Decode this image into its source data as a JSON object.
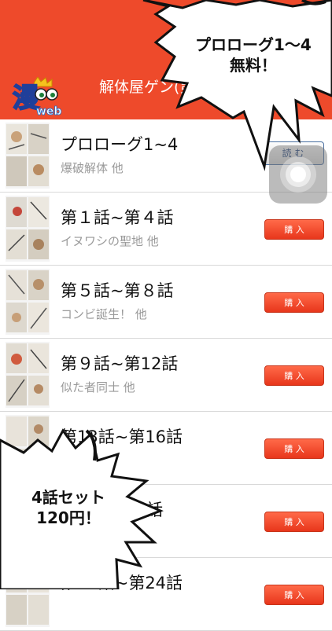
{
  "header": {
    "title": "解体屋ゲン(第",
    "logo_text": "web",
    "logo_char": "漫"
  },
  "episodes": [
    {
      "title": "プロローグ1~4",
      "subtitle": "爆破解体 他",
      "button": "読 む"
    },
    {
      "title": "第１話~第４話",
      "subtitle": "イヌワシの聖地 他",
      "button": "購 入"
    },
    {
      "title": "第５話~第８話",
      "subtitle": "コンビ誕生！ 他",
      "button": "購 入"
    },
    {
      "title": "第９話~第12話",
      "subtitle": "似た者同士 他",
      "button": "購 入"
    },
    {
      "title": "第13話~第16話",
      "subtitle": "",
      "button": "購 入"
    },
    {
      "title": "話",
      "subtitle": "",
      "button": "購 入"
    },
    {
      "title": "第21話~第24話",
      "subtitle": "",
      "button": "購 入"
    }
  ],
  "callouts": {
    "top": {
      "line1": "プロローグ1～4",
      "line2": "無料！"
    },
    "bottom": {
      "line1": "4話セット",
      "line2": "120円！"
    }
  },
  "colors": {
    "header": "#ee4a2b",
    "buy_button": "#ef4427",
    "read_button_text": "#1c3f78"
  }
}
